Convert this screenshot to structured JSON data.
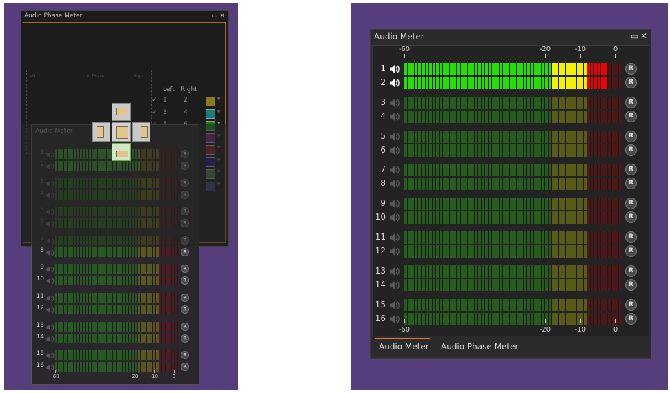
{
  "left_scene": {
    "phase_window": {
      "title": "Audio Phase Meter",
      "quadrant_labels": [
        "Left",
        "In Phase",
        "Right"
      ],
      "routing_headers": [
        "Left",
        "Right"
      ],
      "routing_rows": [
        {
          "left": "1",
          "right": "2",
          "swatch": "#8a7a1e"
        },
        {
          "left": "3",
          "right": "4",
          "swatch": "#1e7a7a"
        },
        {
          "left": "5",
          "right": "6",
          "swatch": "#1e7a1e"
        },
        {
          "left": "",
          "right": "",
          "swatch": "#7a1e7a"
        },
        {
          "left": "",
          "right": "",
          "swatch": "#7a1e1e"
        },
        {
          "left": "",
          "right": "",
          "swatch": "#1e1e7a"
        },
        {
          "left": "",
          "right": "",
          "swatch": "#4a6a3a"
        },
        {
          "left": "",
          "right": "",
          "swatch": "#3a3a6a"
        }
      ]
    },
    "meter_window": {
      "title": "Audio Meter",
      "channels": [
        "1",
        "2",
        "3",
        "4",
        "5",
        "6",
        "7",
        "8",
        "9",
        "10",
        "11",
        "12",
        "13",
        "14",
        "15",
        "16"
      ],
      "scale": [
        "-60",
        "-20",
        "-10",
        "0"
      ],
      "rec": "R"
    }
  },
  "dock": {
    "title": "Audio Meter",
    "maximize_icon": "▭",
    "close_icon": "✕",
    "scale_labels": [
      "-60",
      "-20",
      "-10",
      "0"
    ],
    "rec_label": "R",
    "channels": [
      {
        "num": "1",
        "level": 0.92,
        "active": true
      },
      {
        "num": "2",
        "level": 0.92,
        "active": true
      },
      {
        "num": "3",
        "level": 0,
        "active": false
      },
      {
        "num": "4",
        "level": 0,
        "active": false
      },
      {
        "num": "5",
        "level": 0,
        "active": false
      },
      {
        "num": "6",
        "level": 0,
        "active": false
      },
      {
        "num": "7",
        "level": 0,
        "active": false
      },
      {
        "num": "8",
        "level": 0,
        "active": false
      },
      {
        "num": "9",
        "level": 0,
        "active": false
      },
      {
        "num": "10",
        "level": 0,
        "active": false
      },
      {
        "num": "11",
        "level": 0,
        "active": false
      },
      {
        "num": "12",
        "level": 0,
        "active": false
      },
      {
        "num": "13",
        "level": 0,
        "active": false
      },
      {
        "num": "14",
        "level": 0,
        "active": false
      },
      {
        "num": "15",
        "level": 0,
        "active": false
      },
      {
        "num": "16",
        "level": 0,
        "active": false
      }
    ],
    "tabs": [
      {
        "label": "Audio Meter",
        "active": true
      },
      {
        "label": "Audio Phase Meter",
        "active": false
      }
    ]
  },
  "colors": {
    "background": "#563d7c",
    "green": "#22e000",
    "yellow": "#f2f200",
    "red": "#f00000",
    "green_dim": "#265c1c",
    "yellow_dim": "#5a5a18",
    "red_dim": "#4a1818",
    "accent": "#e07a2a"
  }
}
